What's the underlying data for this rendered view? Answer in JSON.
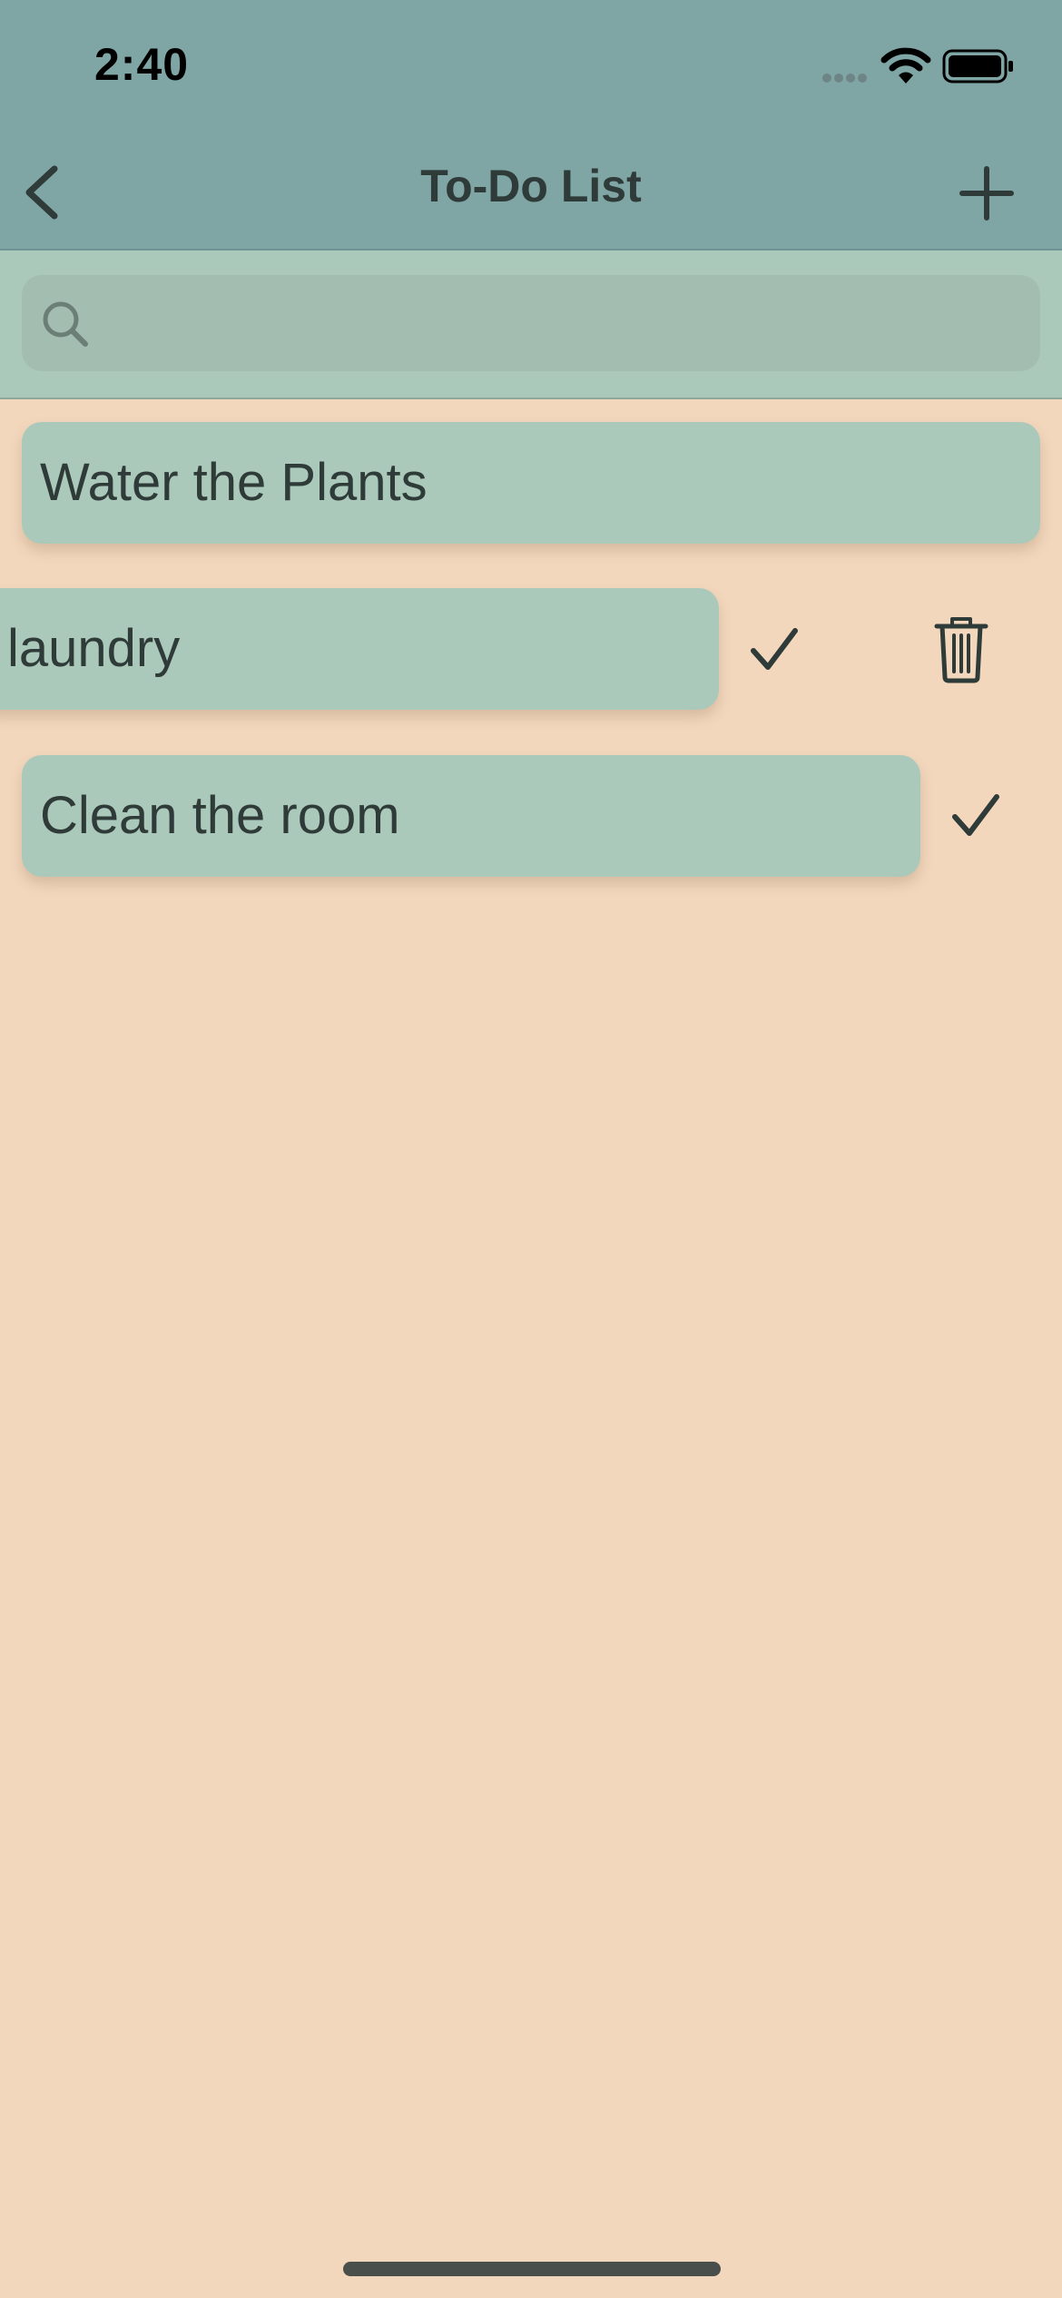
{
  "status_bar": {
    "time": "2:40"
  },
  "nav": {
    "title": "To-Do List",
    "back_icon": "chevron-left-icon",
    "add_icon": "plus-icon"
  },
  "search": {
    "placeholder": "",
    "value": "",
    "icon": "search-icon"
  },
  "tasks": [
    {
      "label": "Water the Plants",
      "actions": []
    },
    {
      "label": "laundry",
      "actions": [
        "checkmark-icon",
        "trash-icon"
      ]
    },
    {
      "label": "Clean the room",
      "actions": [
        "checkmark-icon"
      ]
    }
  ],
  "colors": {
    "header": "#7FA5A5",
    "search_bar": "#ABC9BA",
    "card": "#ABC9BA",
    "background": "#F2D7BD",
    "text": "#2F3B38"
  }
}
